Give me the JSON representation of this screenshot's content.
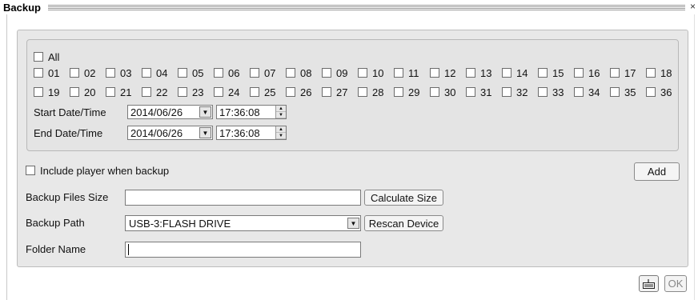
{
  "window": {
    "title": "Backup",
    "close_label": "×"
  },
  "channels": {
    "all_label": "All",
    "row1": [
      "01",
      "02",
      "03",
      "04",
      "05",
      "06",
      "07",
      "08",
      "09",
      "10",
      "11",
      "12",
      "13",
      "14",
      "15",
      "16",
      "17",
      "18"
    ],
    "row2": [
      "19",
      "20",
      "21",
      "22",
      "23",
      "24",
      "25",
      "26",
      "27",
      "28",
      "29",
      "30",
      "31",
      "32",
      "33",
      "34",
      "35",
      "36"
    ]
  },
  "start": {
    "label": "Start Date/Time",
    "date": "2014/06/26",
    "time": "17:36:08"
  },
  "end": {
    "label": "End Date/Time",
    "date": "2014/06/26",
    "time": "17:36:08"
  },
  "include_player": {
    "label": "Include player when backup"
  },
  "add_button": "Add",
  "backup_size": {
    "label": "Backup Files Size",
    "value": "",
    "button": "Calculate Size"
  },
  "backup_path": {
    "label": "Backup Path",
    "value": "USB-3:FLASH DRIVE",
    "button": "Rescan Device"
  },
  "folder_name": {
    "label": "Folder Name",
    "value": ""
  },
  "footer": {
    "ok_label": "OK",
    "keyboard_icon": "keyboard-icon"
  }
}
